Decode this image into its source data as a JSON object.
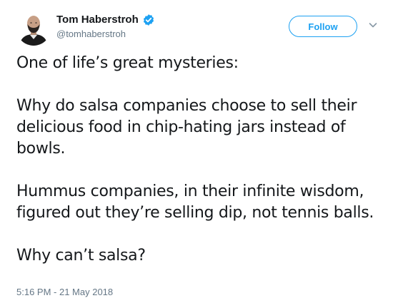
{
  "user": {
    "display_name": "Tom Haberstroh",
    "handle": "@tomhaberstroh",
    "verified_icon": "verified-badge-icon",
    "verified_color": "#1da1f2"
  },
  "actions": {
    "follow_label": "Follow",
    "menu_icon": "chevron-down-icon"
  },
  "tweet": {
    "paragraphs": [
      "One of life’s great mysteries:",
      "Why do salsa companies choose to sell their delicious food in chip-hating jars instead of bowls.",
      "Hummus companies, in their infinite wisdom, figured out they’re selling dip, not tennis balls.",
      "Why can’t salsa?"
    ],
    "timestamp": "5:16 PM - 21 May 2018"
  },
  "colors": {
    "accent": "#1da1f2",
    "text": "#14171a",
    "secondary_text": "#657786"
  }
}
